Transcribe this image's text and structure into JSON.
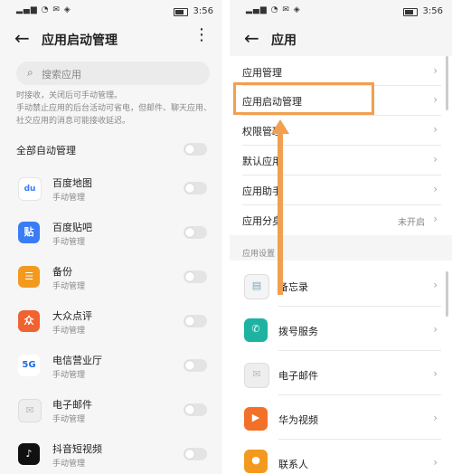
{
  "status": {
    "signal": "³ᴳ ³ᴳ ",
    "time": "3:56"
  },
  "left": {
    "title": "应用启动管理",
    "search_placeholder": "搜索应用",
    "description": "时接收，关闭后可手动管理。\n手动禁止应用的后台活动可省电，但邮件、聊天应用、社交应用的消息可能接收延迟。",
    "all_auto": "全部自动管理",
    "apps": [
      {
        "name": "百度地图",
        "sub": "手动管理",
        "icon": "baidu-map-icon",
        "glyph": "du",
        "color": "#ffffff"
      },
      {
        "name": "百度贴吧",
        "sub": "手动管理",
        "icon": "tieba-icon",
        "glyph": "贴",
        "color": "#3a7cf6"
      },
      {
        "name": "备份",
        "sub": "手动管理",
        "icon": "backup-icon",
        "glyph": "☰",
        "color": "#f39a1e"
      },
      {
        "name": "大众点评",
        "sub": "手动管理",
        "icon": "dianping-icon",
        "glyph": "众",
        "color": "#f06230"
      },
      {
        "name": "电信营业厅",
        "sub": "手动管理",
        "icon": "telecom-icon",
        "glyph": "5G",
        "color": "#ffffff"
      },
      {
        "name": "电子邮件",
        "sub": "手动管理",
        "icon": "email-icon",
        "glyph": "✉",
        "color": "#f0f0f0"
      },
      {
        "name": "抖音短视频",
        "sub": "手动管理",
        "icon": "douyin-icon",
        "glyph": "♪",
        "color": "#111111"
      }
    ]
  },
  "right": {
    "title": "应用",
    "rows": [
      {
        "label": "应用管理",
        "value": ""
      },
      {
        "label": "应用启动管理",
        "value": ""
      },
      {
        "label": "权限管理",
        "value": ""
      },
      {
        "label": "默认应用",
        "value": ""
      },
      {
        "label": "应用助手",
        "value": ""
      },
      {
        "label": "应用分身",
        "value": "未开启"
      }
    ],
    "section": "应用设置",
    "apps": [
      {
        "name": "备忘录",
        "icon": "memo-icon",
        "glyph": "▤",
        "color": "#f2f2f2"
      },
      {
        "name": "拨号服务",
        "icon": "phone-icon",
        "glyph": "✆",
        "color": "#1db3a0"
      },
      {
        "name": "电子邮件",
        "icon": "email-icon",
        "glyph": "✉",
        "color": "#f0f0f0"
      },
      {
        "name": "华为视频",
        "icon": "video-icon",
        "glyph": "▶",
        "color": "#f37028"
      },
      {
        "name": "联系人",
        "icon": "contacts-icon",
        "glyph": "●",
        "color": "#f39a1e"
      }
    ]
  },
  "colors": {
    "accent": "#f0a050"
  }
}
